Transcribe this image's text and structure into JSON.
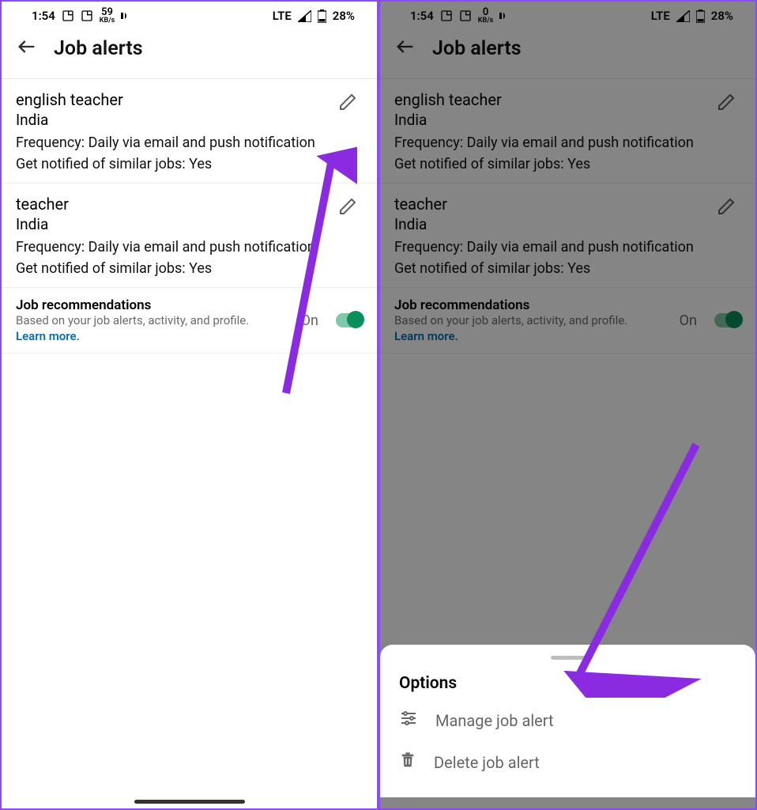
{
  "status": {
    "time": "1:54",
    "net_label": "KB/s",
    "kb_left": "59",
    "kb_right": "0",
    "net_type": "LTE",
    "battery": "28%"
  },
  "header": {
    "title": "Job alerts"
  },
  "alerts": [
    {
      "title": "english teacher",
      "location": "India",
      "frequency": "Frequency: Daily via email and push notification",
      "similar": "Get notified of similar jobs: Yes"
    },
    {
      "title": "teacher",
      "location": "India",
      "frequency": "Frequency: Daily via email and push notification",
      "similar": "Get notified of similar jobs: Yes"
    }
  ],
  "recs": {
    "title": "Job recommendations",
    "subtitle": "Based on your job alerts, activity, and profile.",
    "learn": "Learn more.",
    "state": "On"
  },
  "sheet": {
    "title": "Options",
    "manage": "Manage job alert",
    "delete": "Delete job alert"
  }
}
